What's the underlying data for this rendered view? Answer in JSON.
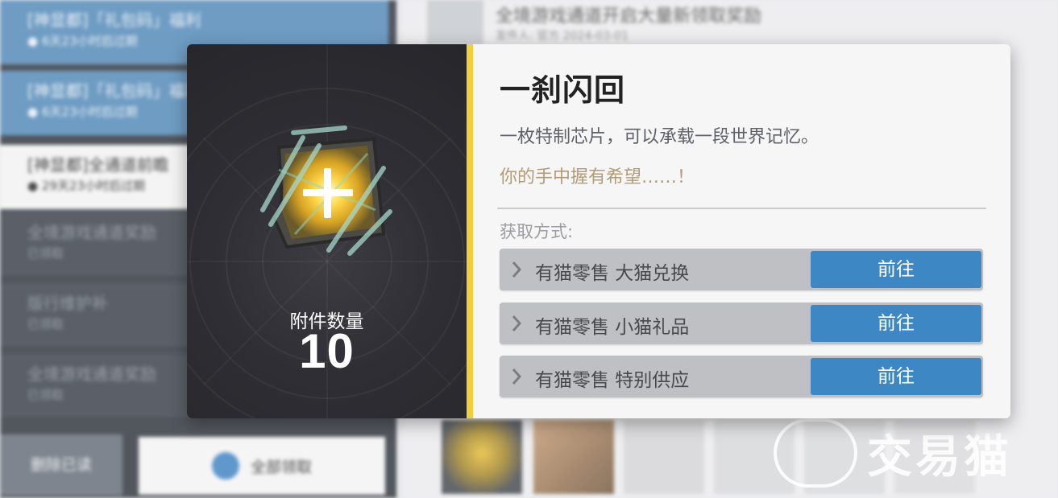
{
  "background": {
    "mails": [
      {
        "title": "[神显都]「礼包码」福利",
        "sub": "● 6天23小时后过期",
        "style": "blue"
      },
      {
        "title": "[神显都]「礼包码」福利",
        "sub": "● 6天23小时后过期",
        "style": "blue"
      },
      {
        "title": "[神显都]全通道前瞻",
        "sub": "● 29天23小时后过期",
        "style": "white"
      },
      {
        "title": "全境游戏通道奖励",
        "sub": "已领取",
        "style": "dark"
      },
      {
        "title": "版行维护补",
        "sub": "已领取",
        "style": "dark"
      },
      {
        "title": "全境游戏通道奖励",
        "sub": "已领取",
        "style": "dark"
      }
    ],
    "left_button_label": "删除已读",
    "right_button_label": "全部领取",
    "header_title": "全境游戏通道开启大量新领取奖励",
    "header_meta": "发件人: 官方  2024-03-01",
    "watermark_text": "交易猫"
  },
  "popup": {
    "item_name": "一刹闪回",
    "description": "一枚特制芯片，可以承载一段世界记忆。",
    "flavor_text": "你的手中握有希望……！",
    "quantity_label": "附件数量",
    "quantity_value": "10",
    "accent_color": "#f0cf3a",
    "icon": "glowing-chip-icon",
    "sources_title": "获取方式:",
    "sources": [
      {
        "label": "有猫零售 大猫兑换",
        "button": "前往"
      },
      {
        "label": "有猫零售 小猫礼品",
        "button": "前往"
      },
      {
        "label": "有猫零售 特别供应",
        "button": "前往"
      }
    ]
  }
}
